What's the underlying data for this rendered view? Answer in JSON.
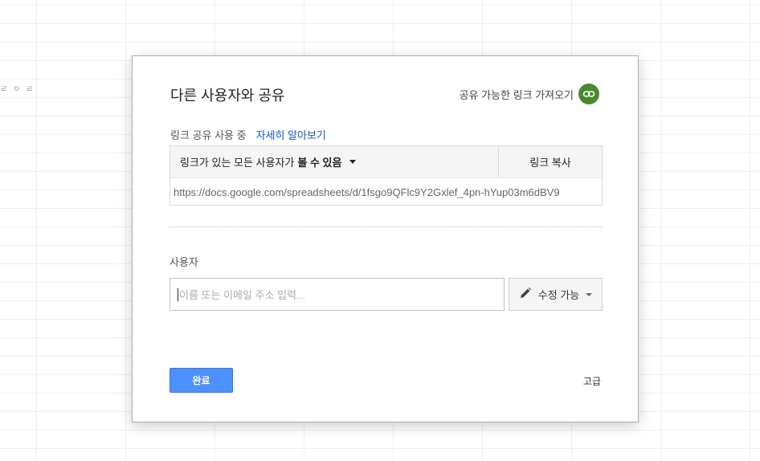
{
  "background": {
    "fragment": "ㄹ ㅇ ㄹ"
  },
  "dialog": {
    "title": "다른 사용자와 공유",
    "get_link_label": "공유 가능한 링크 가져오기",
    "link_icon": "link-icon",
    "link_icon_color": "#4a8a2e",
    "status_text": "링크 공유 사용 중",
    "learn_more": "자세히 알아보기",
    "access": {
      "prefix": "링크가 있는 모든 사용자가",
      "level": "볼 수 있음"
    },
    "copy_link_label": "링크 복사",
    "url": "https://docs.google.com/spreadsheets/d/1fsgo9QFlc9Y2Gxlef_4pn-hYup03m6dBV9",
    "people_label": "사용자",
    "people_input_placeholder": "이름 또는 이메일 주소 입력...",
    "permission_label": "수정 가능",
    "permission_icon": "pencil-icon",
    "done_label": "완료",
    "done_color": "#4d90fe",
    "advanced_label": "고급"
  }
}
